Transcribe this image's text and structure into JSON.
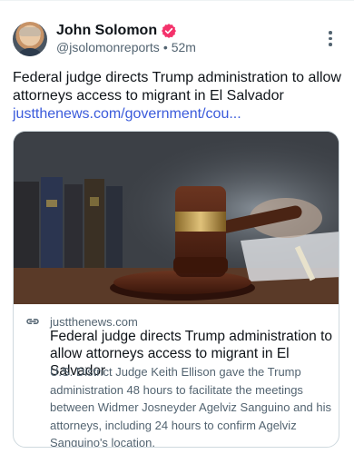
{
  "post": {
    "author_name": "John Solomon",
    "handle": "@jsolomonreports",
    "separator": "•",
    "time": "52m",
    "text": "Federal judge directs Trump administration to allow attorneys access to migrant in El Salvador",
    "link_text": "justthenews.com/government/cou..."
  },
  "card": {
    "domain": "justthenews.com",
    "title": "Federal judge directs Trump administration to allow attorneys access to migrant in El Salvador",
    "description": "U.S. District Judge Keith Ellison gave the Trump administration 48 hours to facilitate the meetings between Widmer Josneyder Agelviz Sanguino and his attorneys, including 24 hours to confirm Agelviz Sanguino's location."
  },
  "icons": {
    "verified": "verified-badge-icon",
    "more": "more-vertical-icon",
    "link": "link-icon"
  },
  "colors": {
    "verified_badge": "#f4326b",
    "link": "#3b5bdb",
    "secondary_text": "#536471"
  }
}
